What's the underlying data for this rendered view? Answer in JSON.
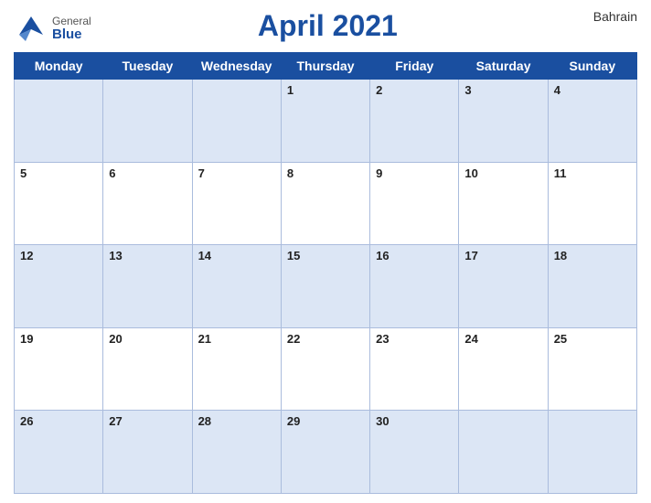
{
  "header": {
    "title": "April 2021",
    "country": "Bahrain",
    "logo": {
      "general": "General",
      "blue": "Blue"
    }
  },
  "weekdays": [
    "Monday",
    "Tuesday",
    "Wednesday",
    "Thursday",
    "Friday",
    "Saturday",
    "Sunday"
  ],
  "weeks": [
    [
      null,
      null,
      null,
      1,
      2,
      3,
      4
    ],
    [
      5,
      6,
      7,
      8,
      9,
      10,
      11
    ],
    [
      12,
      13,
      14,
      15,
      16,
      17,
      18
    ],
    [
      19,
      20,
      21,
      22,
      23,
      24,
      25
    ],
    [
      26,
      27,
      28,
      29,
      30,
      null,
      null
    ]
  ]
}
